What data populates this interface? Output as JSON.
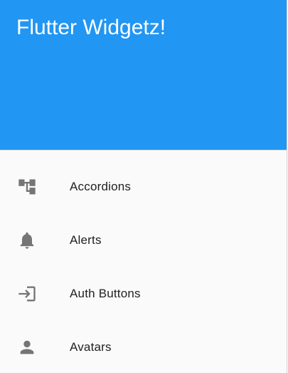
{
  "header": {
    "title": "Flutter Widgetz!",
    "background_color": "#2196f3"
  },
  "menu": {
    "items": [
      {
        "label": "Accordions",
        "icon": "account-tree-icon"
      },
      {
        "label": "Alerts",
        "icon": "bell-icon"
      },
      {
        "label": "Auth Buttons",
        "icon": "login-icon"
      },
      {
        "label": "Avatars",
        "icon": "person-icon"
      }
    ]
  },
  "colors": {
    "icon": "#757575",
    "text": "#212121"
  }
}
